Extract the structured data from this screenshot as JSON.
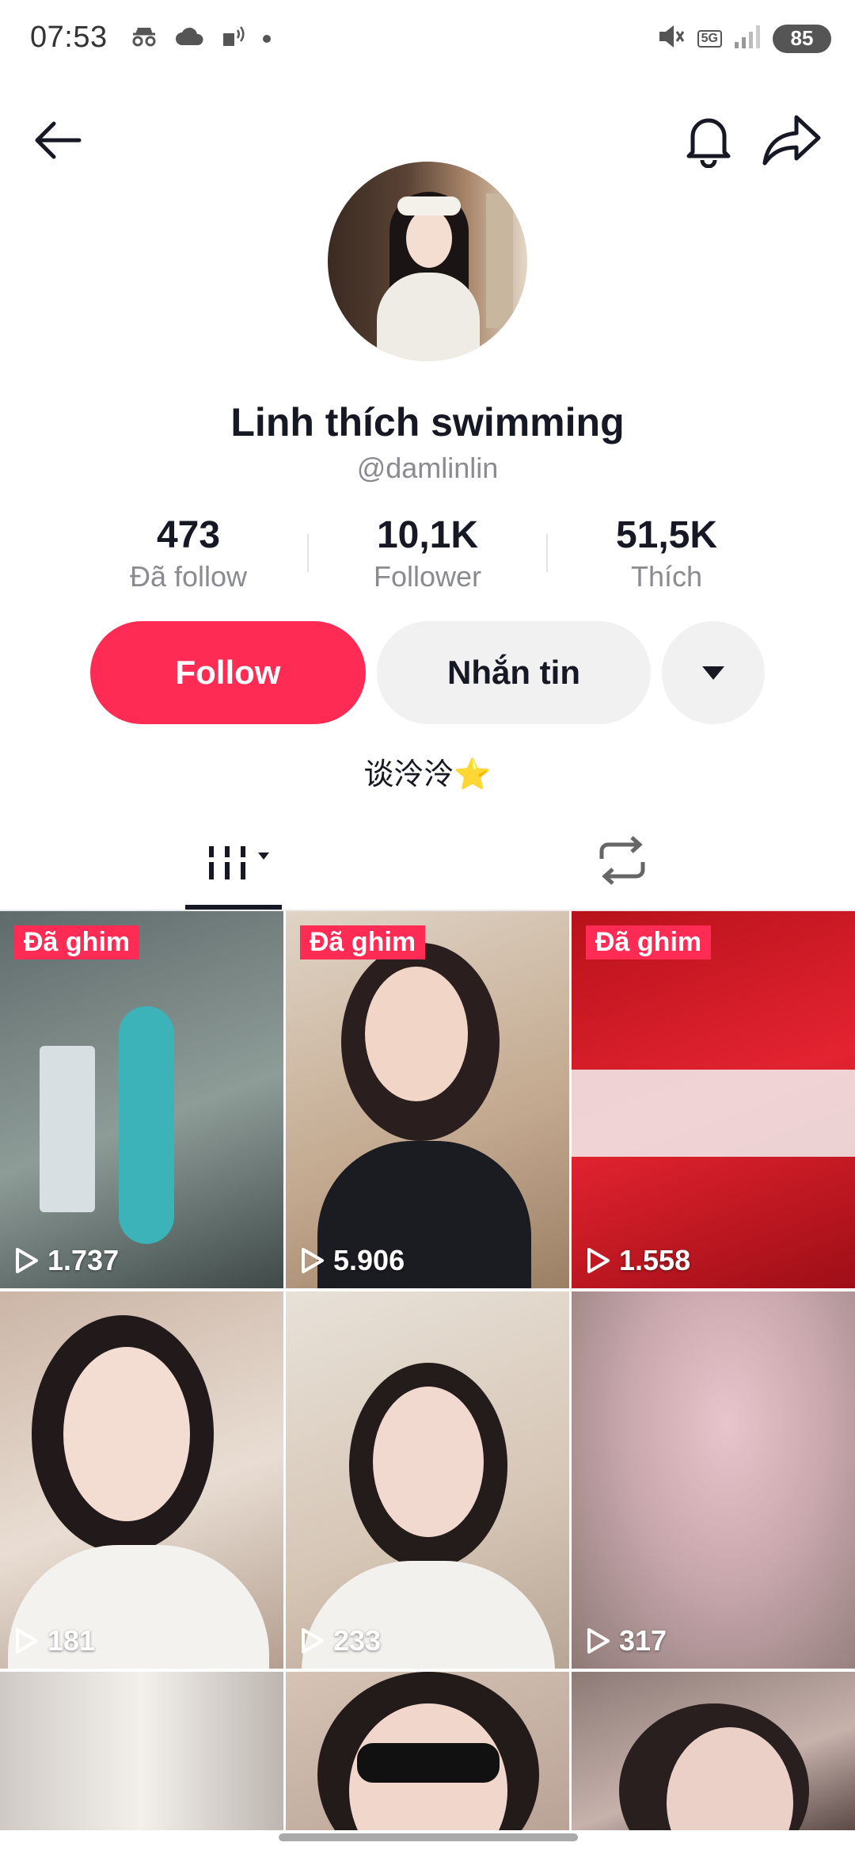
{
  "status_bar": {
    "time": "07:53",
    "battery": "85",
    "network": "5G"
  },
  "profile": {
    "display_name": "Linh thích swimming",
    "handle": "@damlinlin",
    "bio": "谈泠泠",
    "bio_emoji": "⭐"
  },
  "stats": [
    {
      "value": "473",
      "label": "Đã follow"
    },
    {
      "value": "10,1K",
      "label": "Follower"
    },
    {
      "value": "51,5K",
      "label": "Thích"
    }
  ],
  "actions": {
    "follow": "Follow",
    "message": "Nhắn tin"
  },
  "videos": [
    {
      "pinned_label": "Đã ghim",
      "views": "1.737",
      "bg": "#7a8a8c"
    },
    {
      "pinned_label": "Đã ghim",
      "views": "5.906",
      "bg": "#c9b8a6"
    },
    {
      "pinned_label": "Đã ghim",
      "views": "1.558",
      "bg": "#d0191f"
    },
    {
      "pinned_label": "",
      "views": "181",
      "bg": "#d9c8bb"
    },
    {
      "pinned_label": "",
      "views": "233",
      "bg": "#e6dcd2"
    },
    {
      "pinned_label": "",
      "views": "317",
      "bg": "#c9aab0"
    },
    {
      "pinned_label": "",
      "views": "",
      "bg": "#ddd8d3"
    },
    {
      "pinned_label": "",
      "views": "",
      "bg": "#cbb9ae"
    },
    {
      "pinned_label": "",
      "views": "",
      "bg": "#a89590"
    }
  ],
  "colors": {
    "accent": "#fe2c55",
    "text": "#161823",
    "secondary": "#8a8b91"
  }
}
